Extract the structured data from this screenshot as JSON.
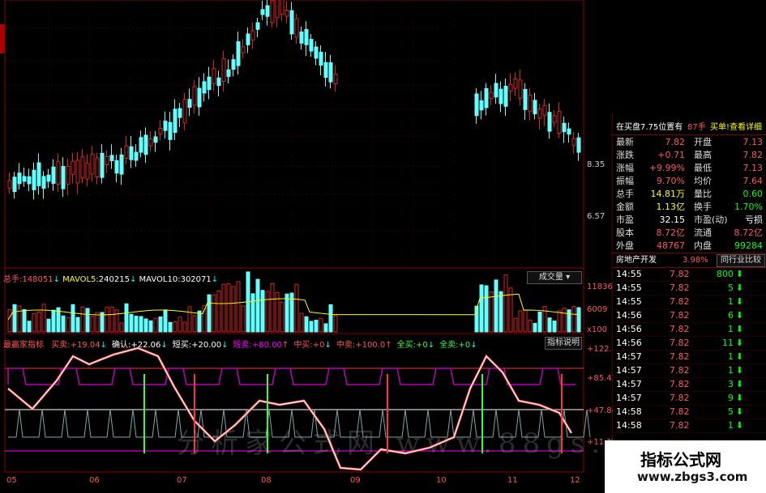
{
  "colors": {
    "up": "#d22",
    "down": "#6ff",
    "grid": "#8a0000",
    "white": "#fff",
    "yellow": "#ff0",
    "green": "#3f3",
    "magenta": "#f0f",
    "red": "#f33"
  },
  "price_axis": {
    "labels": [
      "8.35",
      "6.57"
    ]
  },
  "volume_header": {
    "total_label": "总手:",
    "total_value": "148051",
    "mavol5_label": "MAVOL5:",
    "mavol5_value": "240215",
    "mavol10_label": "MAVOL10:",
    "mavol10_value": "302071",
    "dropdown_label": "成交量",
    "axis": [
      "11836",
      "6009",
      "x100"
    ]
  },
  "indicator_header": {
    "name": "最赢家指标",
    "items": [
      {
        "label": "买卖:",
        "value": "+19.04"
      },
      {
        "label": "确认:",
        "value": "+22.06"
      },
      {
        "label": "短买:",
        "value": "+20.00"
      },
      {
        "label": "短卖:",
        "value": "+80.00"
      },
      {
        "label": "中买:",
        "value": "+0"
      },
      {
        "label": "中卖:",
        "value": "+100.0"
      },
      {
        "label": "全买:",
        "value": "+0"
      },
      {
        "label": "全卖:",
        "value": "+0"
      }
    ],
    "help_button": "指标说明",
    "axis": [
      "+122.1",
      "+85.42",
      "+47.84",
      "+11.12"
    ]
  },
  "date_axis": [
    "05",
    "06",
    "07",
    "08",
    "09",
    "10",
    "11",
    "12"
  ],
  "quote": {
    "header_left": "在买盘7.75位置有",
    "header_mid": "87手",
    "header_right": "买单!查看详细",
    "rows": [
      {
        "l1": "最新",
        "v1": "7.82",
        "l2": "开盘",
        "v2": "7.13"
      },
      {
        "l1": "涨跌",
        "v1": "+0.71",
        "l2": "最高",
        "v2": "7.82"
      },
      {
        "l1": "涨幅",
        "v1": "+9.99%",
        "l2": "最低",
        "v2": "7.13"
      },
      {
        "l1": "振幅",
        "v1": "9.70%",
        "l2": "均价",
        "v2": "7.64"
      },
      {
        "l1": "总手",
        "v1": "14.81万",
        "l2": "量比",
        "v2": "0.60"
      },
      {
        "l1": "金额",
        "v1": "1.13亿",
        "l2": "换手",
        "v2": "1.70%"
      },
      {
        "l1": "市盈",
        "v1": "32.15",
        "l2": "市盈(动)",
        "v2": "亏损"
      },
      {
        "l1": "股本",
        "v1": "8.72亿",
        "l2": "流通",
        "v2": "8.72亿"
      },
      {
        "l1": "外盘",
        "v1": "48767",
        "l2": "内盘",
        "v2": "99284"
      }
    ],
    "sector": "房地产开发",
    "sector_pct": "3.98%",
    "compare_button": "同行业比较"
  },
  "ticks": [
    {
      "t": "14:55",
      "p": "7.82",
      "v": "800"
    },
    {
      "t": "14:55",
      "p": "7.82",
      "v": "5"
    },
    {
      "t": "14:55",
      "p": "7.82",
      "v": "1"
    },
    {
      "t": "14:56",
      "p": "7.82",
      "v": "6"
    },
    {
      "t": "14:56",
      "p": "7.82",
      "v": "1"
    },
    {
      "t": "14:56",
      "p": "7.82",
      "v": "11"
    },
    {
      "t": "14:57",
      "p": "7.82",
      "v": "1"
    },
    {
      "t": "14:57",
      "p": "7.82",
      "v": "1"
    },
    {
      "t": "14:57",
      "p": "7.82",
      "v": "3"
    },
    {
      "t": "14:57",
      "p": "7.82",
      "v": "9"
    },
    {
      "t": "14:58",
      "p": "7.82",
      "v": "5"
    },
    {
      "t": "14:58",
      "p": "7.82",
      "v": "1"
    }
  ],
  "watermark": "分析家公式网 www.88gs.com",
  "brand": {
    "title": "指标公式网",
    "url": "www.zbgs3.com"
  }
}
